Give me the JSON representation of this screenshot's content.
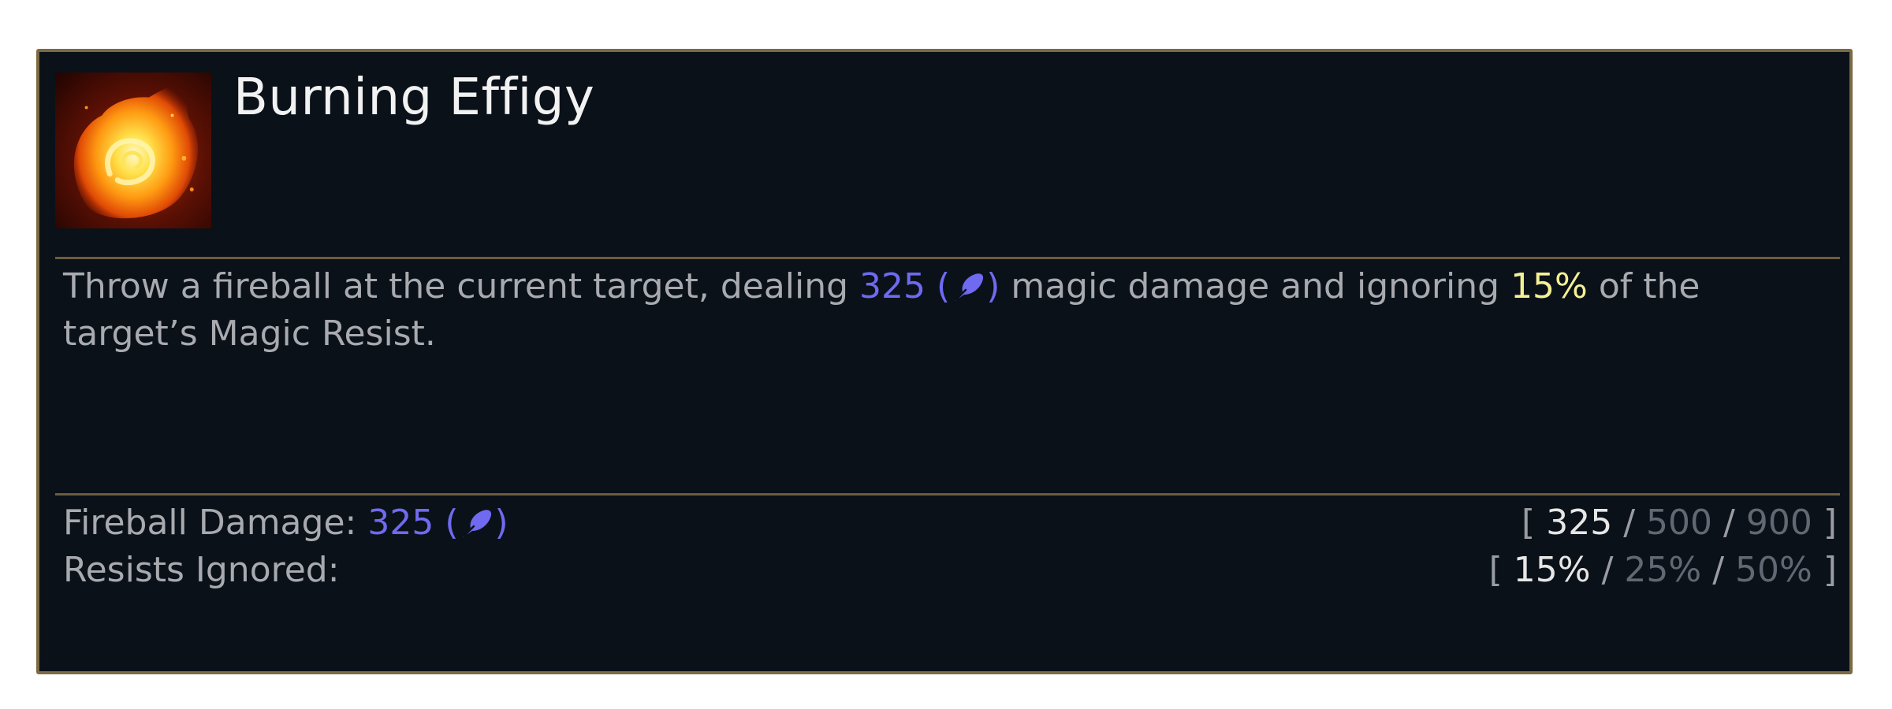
{
  "ability": {
    "name": "Burning Effigy",
    "icon": "fireball-icon"
  },
  "description": {
    "part1": "Throw a fireball at the current target, dealing ",
    "damage_value": "325",
    "paren_open": " (",
    "ap_icon": "ability-power-icon",
    "paren_close": ")",
    "part2": " magic damage and ignoring ",
    "resist_value": "15%",
    "part3": " of the target’s Magic Resist."
  },
  "stats": [
    {
      "label": "Fireball Damage: ",
      "value": "325",
      "paren_open": " (",
      "paren_close": ")",
      "scale_open": "[",
      "scale_close": "]",
      "sep": "/",
      "scale": [
        "325",
        "500",
        "900"
      ]
    },
    {
      "label": "Resists Ignored:",
      "scale_open": "[",
      "scale_close": "]",
      "sep": "/",
      "scale": [
        "15%",
        "25%",
        "50%"
      ]
    }
  ],
  "colors": {
    "background": "#0a1119",
    "border": "#7c6a42",
    "ability_power": "#6f6af0",
    "highlight": "#f4f094",
    "text": "#a8aab0"
  }
}
